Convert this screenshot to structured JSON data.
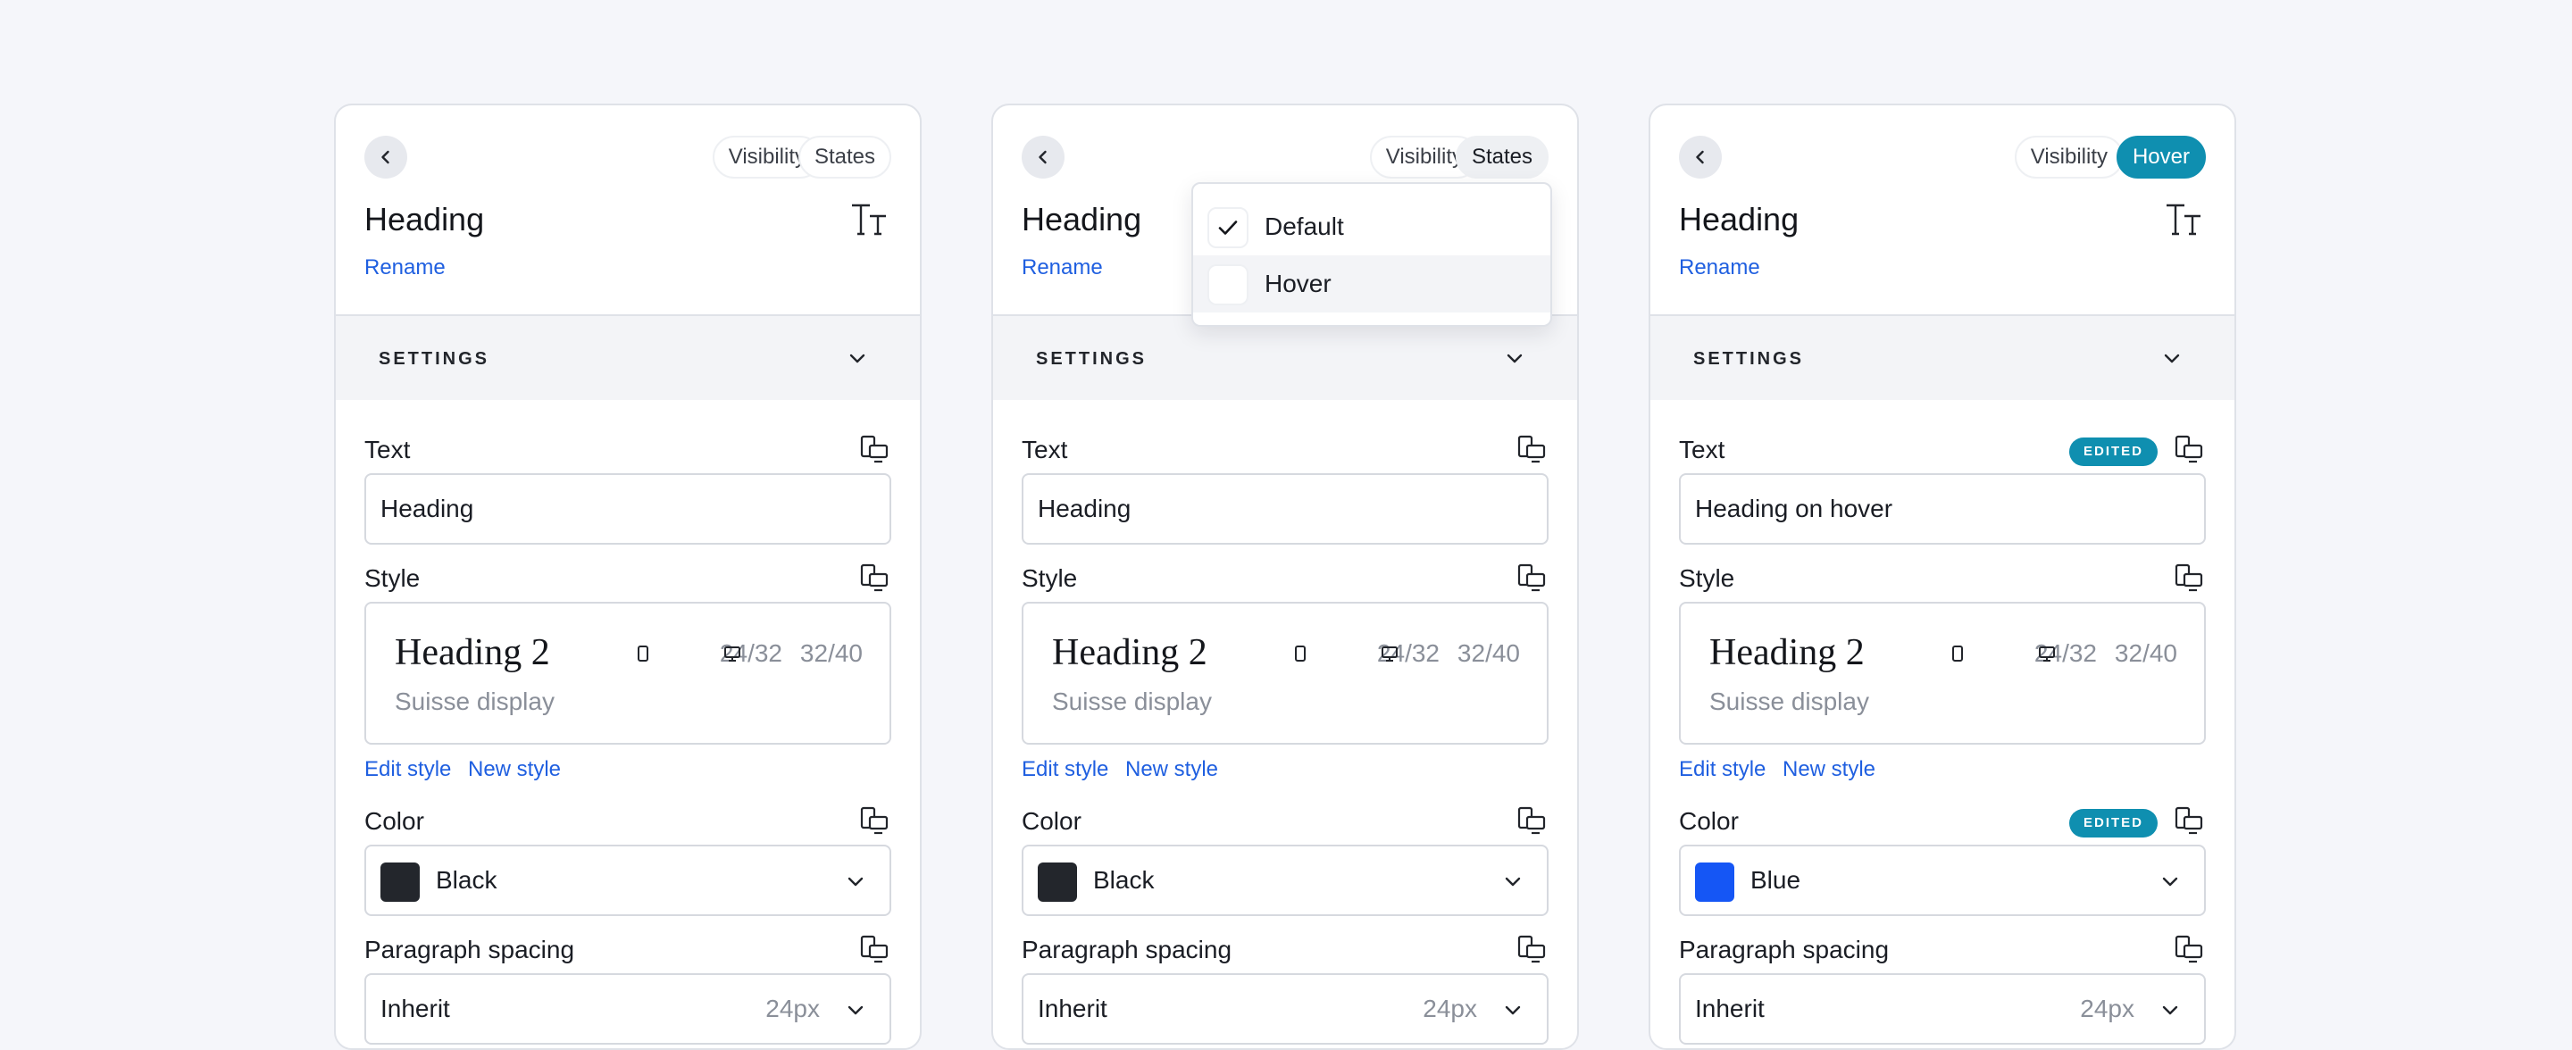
{
  "colors": {
    "accent_link": "#1f5fe0",
    "teal": "#0f8fb0",
    "black_swatch": "#23262c",
    "blue_swatch": "#1556f5"
  },
  "panels": [
    {
      "pills": {
        "visibility": "Visibility",
        "states": "States"
      },
      "heading": "Heading",
      "rename": "Rename",
      "settings": "SETTINGS",
      "text_label": "Text",
      "text_value": "Heading",
      "style_label": "Style",
      "style_name": "Heading 2",
      "style_font": "Suisse display",
      "mobile_metric": "24/32",
      "desktop_metric": "32/40",
      "edit_style": "Edit style",
      "new_style": "New style",
      "color_label": "Color",
      "color_value": "Black",
      "color_swatch": "#23262c",
      "para_label": "Paragraph spacing",
      "para_value": "Inherit",
      "para_px": "24px"
    },
    {
      "pills": {
        "visibility": "Visibility",
        "states": "States"
      },
      "heading": "Heading",
      "rename": "Rename",
      "settings": "SETTINGS",
      "text_label": "Text",
      "text_value": "Heading",
      "style_label": "Style",
      "style_name": "Heading 2",
      "style_font": "Suisse display",
      "mobile_metric": "24/32",
      "desktop_metric": "32/40",
      "edit_style": "Edit style",
      "new_style": "New style",
      "color_label": "Color",
      "color_value": "Black",
      "color_swatch": "#23262c",
      "para_label": "Paragraph spacing",
      "para_value": "Inherit",
      "para_px": "24px",
      "dropdown": {
        "items": [
          "Default",
          "Hover"
        ],
        "selected": "Default"
      }
    },
    {
      "pills": {
        "visibility": "Visibility",
        "states": "Hover"
      },
      "heading": "Heading",
      "rename": "Rename",
      "settings": "SETTINGS",
      "text_label": "Text",
      "text_badge": "EDITED",
      "text_value": "Heading on hover",
      "style_label": "Style",
      "style_name": "Heading 2",
      "style_font": "Suisse display",
      "mobile_metric": "24/32",
      "desktop_metric": "32/40",
      "edit_style": "Edit style",
      "new_style": "New style",
      "color_label": "Color",
      "color_badge": "EDITED",
      "color_value": "Blue",
      "color_swatch": "#1556f5",
      "para_label": "Paragraph spacing",
      "para_value": "Inherit",
      "para_px": "24px"
    }
  ]
}
